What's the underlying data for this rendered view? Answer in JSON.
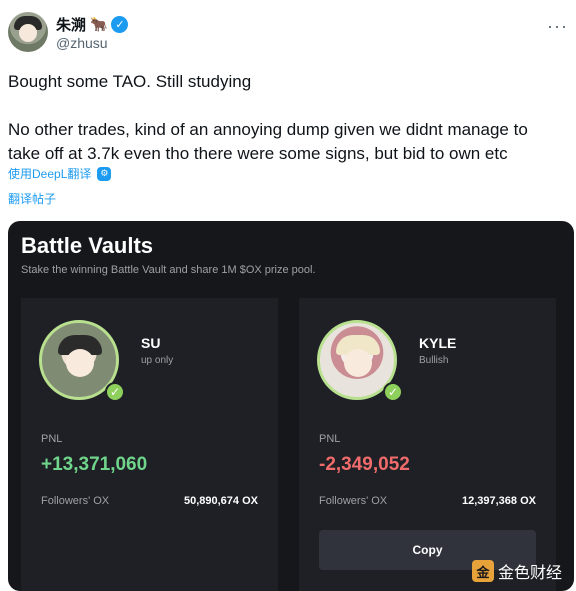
{
  "tweet": {
    "author": {
      "display_name": "朱溯",
      "handle": "@zhusu",
      "badge_emoji": "🐂",
      "verified_icon": "verified-badge-icon"
    },
    "more_icon": "···",
    "paragraphs": [
      "Bought some TAO. Still studying",
      "No other trades, kind of an annoying dump given we didnt manage to take off at 3.7k even tho there were some signs, but bid to own etc"
    ],
    "translated_by": "使用DeepL翻译",
    "translate_post": "翻译帖子"
  },
  "card": {
    "title": "Battle Vaults",
    "subtitle": "Stake the winning Battle Vault and share 1M $OX prize pool.",
    "vaults": [
      {
        "name": "SU",
        "tag": "up only",
        "pnl_label": "PNL",
        "pnl_value": "+13,371,060",
        "followers_label": "Followers' OX",
        "followers_value": "50,890,674 OX"
      },
      {
        "name": "KYLE",
        "tag": "Bullish",
        "pnl_label": "PNL",
        "pnl_value": "-2,349,052",
        "followers_label": "Followers' OX",
        "followers_value": "12,397,368 OX",
        "button_label": "Copy"
      }
    ],
    "watermark": "金色财经"
  },
  "colors": {
    "positive": "#6fd58a",
    "negative": "#f06b6b",
    "accent_blue": "#1d9bf0",
    "card_bg": "#16171b"
  }
}
